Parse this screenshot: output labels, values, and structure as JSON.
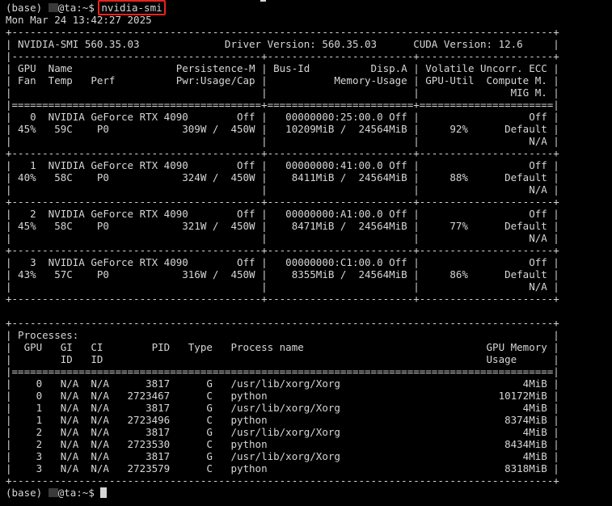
{
  "terminal": {
    "prompt_prefix": "(base) ",
    "prompt_suffix": "@ta:~$ ",
    "command": "nvidia-smi",
    "output_lines": [
      "Mon Mar 24 13:42:27 2025",
      "+-----------------------------------------------------------------------------------------+",
      "| NVIDIA-SMI 560.35.03              Driver Version: 560.35.03      CUDA Version: 12.6     |",
      "|-----------------------------------------+------------------------+----------------------+",
      "| GPU  Name                 Persistence-M | Bus-Id          Disp.A | Volatile Uncorr. ECC |",
      "| Fan  Temp   Perf          Pwr:Usage/Cap |           Memory-Usage | GPU-Util  Compute M. |",
      "|                                         |                        |               MIG M. |",
      "|=========================================+========================+======================|",
      "|   0  NVIDIA GeForce RTX 4090        Off |   00000000:25:00.0 Off |                  Off |",
      "| 45%   59C    P0            309W /  450W |   10209MiB /  24564MiB |     92%      Default |",
      "|                                         |                        |                  N/A |",
      "+-----------------------------------------+------------------------+----------------------+",
      "|   1  NVIDIA GeForce RTX 4090        Off |   00000000:41:00.0 Off |                  Off |",
      "| 40%   58C    P0            324W /  450W |    8411MiB /  24564MiB |     88%      Default |",
      "|                                         |                        |                  N/A |",
      "+-----------------------------------------+------------------------+----------------------+",
      "|   2  NVIDIA GeForce RTX 4090        Off |   00000000:A1:00.0 Off |                  Off |",
      "| 45%   58C    P0            321W /  450W |    8471MiB /  24564MiB |     77%      Default |",
      "|                                         |                        |                  N/A |",
      "+-----------------------------------------+------------------------+----------------------+",
      "|   3  NVIDIA GeForce RTX 4090        Off |   00000000:C1:00.0 Off |                  Off |",
      "| 43%   57C    P0            316W /  450W |    8355MiB /  24564MiB |     86%      Default |",
      "|                                         |                        |                  N/A |",
      "+-----------------------------------------+------------------------+----------------------+",
      "",
      "+-----------------------------------------------------------------------------------------+",
      "| Processes:                                                                              |",
      "|  GPU   GI   CI        PID   Type   Process name                              GPU Memory |",
      "|        ID   ID                                                               Usage      |",
      "|=========================================================================================|",
      "|    0   N/A  N/A      3817      G   /usr/lib/xorg/Xorg                              4MiB |",
      "|    0   N/A  N/A   2723467      C   python                                      10172MiB |",
      "|    1   N/A  N/A      3817      G   /usr/lib/xorg/Xorg                              4MiB |",
      "|    1   N/A  N/A   2723496      C   python                                       8374MiB |",
      "|    2   N/A  N/A      3817      G   /usr/lib/xorg/Xorg                              4MiB |",
      "|    2   N/A  N/A   2723530      C   python                                       8434MiB |",
      "|    3   N/A  N/A      3817      G   /usr/lib/xorg/Xorg                              4MiB |",
      "|    3   N/A  N/A   2723579      C   python                                       8318MiB |",
      "+-----------------------------------------------------------------------------------------+"
    ]
  },
  "colors": {
    "background": "#000000",
    "foreground": "#d6d6d6",
    "highlight_box": "#e8231d"
  }
}
